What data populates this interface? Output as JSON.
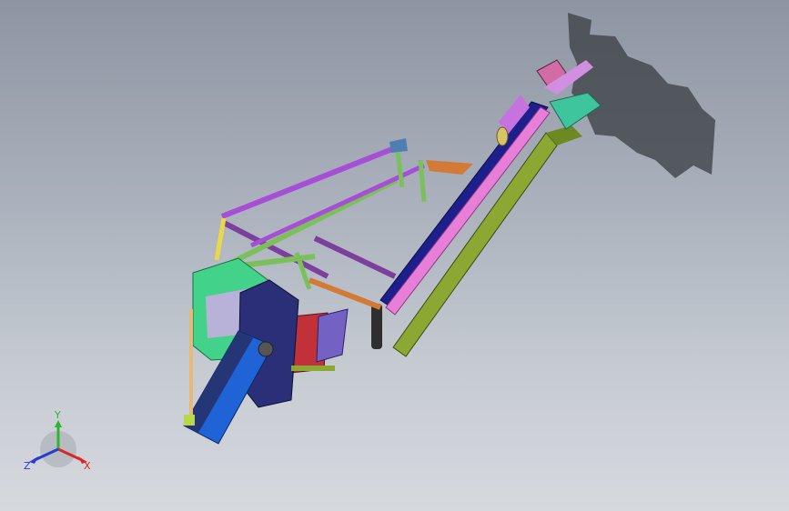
{
  "viewport": {
    "background_top": "#8d95a2",
    "background_bottom": "#d6d9de",
    "shadow_color": "#3e4147"
  },
  "model": {
    "colors": {
      "conveyor_pink": "#e77fd8",
      "conveyor_navy": "#1d1f8c",
      "conveyor_olive": "#8aa832",
      "hopper_navy": "#2a2f78",
      "hopper_blue": "#1f63d6",
      "frame_green": "#7cc05c",
      "frame_purple": "#a64fd6",
      "frame_violet": "#7d3f9e",
      "frame_yellow": "#e9d84a",
      "bracket_orange": "#d37a36",
      "chute_teal": "#3fc59e",
      "panel_green": "#43d28a",
      "door_red": "#c0313a",
      "panel_lavender": "#b9b2d8"
    }
  },
  "triad": {
    "y_label": "Y",
    "x_label": "X",
    "z_label": "Z",
    "y_color": "#2db52d",
    "x_color": "#d8262a",
    "z_color": "#2a3ad0"
  }
}
